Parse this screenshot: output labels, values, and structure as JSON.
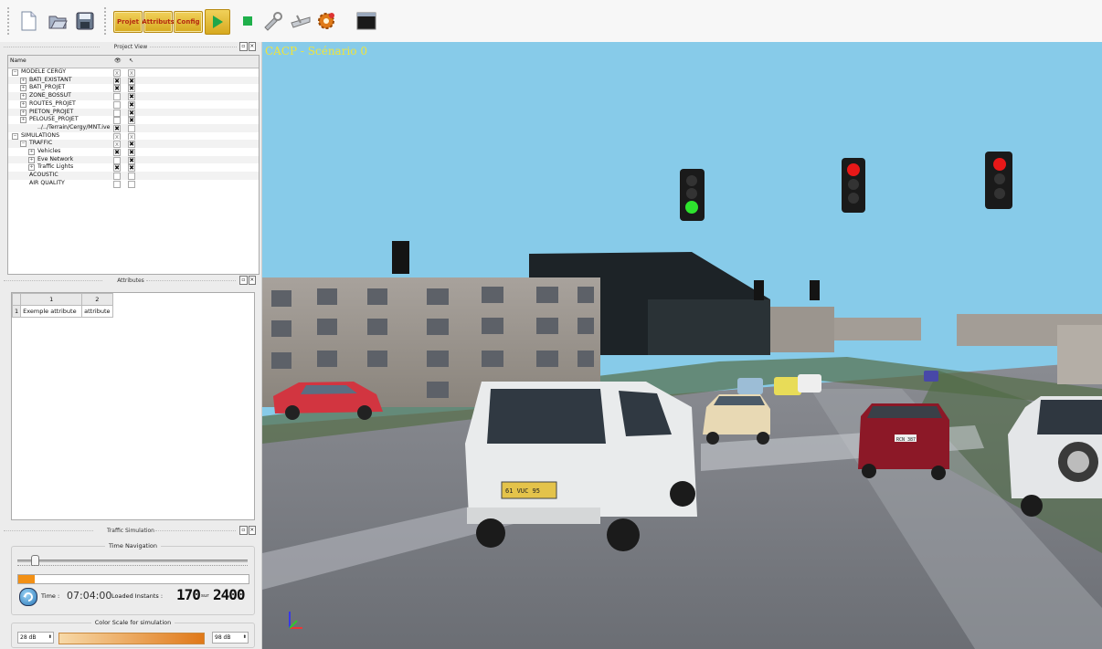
{
  "toolbar": {
    "buttons": [
      "new-file",
      "open-file",
      "save-file",
      "project",
      "attributes",
      "config",
      "play",
      "stop",
      "tools-a",
      "tools-b",
      "settings",
      "terminal"
    ],
    "mode_labels": {
      "project": "Projet",
      "attributes": "Attributs",
      "config": "Config"
    }
  },
  "project_view": {
    "title": "Project View",
    "columns": {
      "name": "Name"
    },
    "rows": [
      {
        "label": "MODELE CERGY",
        "indent": 0,
        "exp": "−",
        "vis": "x",
        "sel": "x",
        "visbold": false,
        "selbold": false
      },
      {
        "label": "BATI_EXISTANT",
        "indent": 1,
        "exp": "+",
        "vis": "✖",
        "sel": "✖",
        "visbold": true,
        "selbold": true
      },
      {
        "label": "BATI_PROJET",
        "indent": 1,
        "exp": "+",
        "vis": "✖",
        "sel": "✖",
        "visbold": true,
        "selbold": true
      },
      {
        "label": "ZONE_BOSSUT",
        "indent": 1,
        "exp": "+",
        "vis": "",
        "sel": "✖",
        "visbold": false,
        "selbold": true
      },
      {
        "label": "ROUTES_PROJET",
        "indent": 1,
        "exp": "+",
        "vis": "",
        "sel": "✖",
        "visbold": false,
        "selbold": true
      },
      {
        "label": "PIETON_PROJET",
        "indent": 1,
        "exp": "+",
        "vis": "",
        "sel": "✖",
        "visbold": false,
        "selbold": true
      },
      {
        "label": "PELOUSE_PROJET",
        "indent": 1,
        "exp": "+",
        "vis": "",
        "sel": "✖",
        "visbold": false,
        "selbold": true
      },
      {
        "label": "../../Terrain/Cergy/MNT.ive",
        "indent": 2,
        "exp": "",
        "vis": "✖",
        "sel": "",
        "visbold": true,
        "selbold": false
      },
      {
        "label": "SIMULATIONS",
        "indent": 0,
        "exp": "−",
        "vis": "x",
        "sel": "x",
        "visbold": false,
        "selbold": false
      },
      {
        "label": "TRAFFIC",
        "indent": 1,
        "exp": "−",
        "vis": "x",
        "sel": "✖",
        "visbold": false,
        "selbold": true
      },
      {
        "label": "Vehicles",
        "indent": 2,
        "exp": "+",
        "vis": "✖",
        "sel": "✖",
        "visbold": true,
        "selbold": true
      },
      {
        "label": "Eve Network",
        "indent": 2,
        "exp": "+",
        "vis": "",
        "sel": "✖",
        "visbold": false,
        "selbold": true
      },
      {
        "label": "Traffic Lights",
        "indent": 2,
        "exp": "+",
        "vis": "✖",
        "sel": "✖",
        "visbold": true,
        "selbold": true
      },
      {
        "label": "ACOUSTIC",
        "indent": 1,
        "exp": "",
        "vis": "",
        "sel": "",
        "visbold": false,
        "selbold": false
      },
      {
        "label": "AIR QUALITY",
        "indent": 1,
        "exp": "",
        "vis": "",
        "sel": "",
        "visbold": false,
        "selbold": false
      }
    ]
  },
  "attributes": {
    "title": "Attributes",
    "col1": "1",
    "col2": "2",
    "row_num": "1",
    "cell1": "Exemple attribute",
    "cell2": "attribute"
  },
  "traffic": {
    "title": "Traffic Simulation",
    "time_nav": "Time Navigation",
    "time_label": "Time :",
    "time_value": "07:04:00",
    "loaded_label": "Loaded Instants :",
    "loaded_value": "170",
    "sur": "sur",
    "total_value": "2400",
    "progress_fraction": 0.07,
    "color_scale": "Color Scale for simulation",
    "min_db": "28 dB",
    "max_db": "98 dB"
  },
  "viewport": {
    "scene_title": "CACP - Scénario 0",
    "plate_van": "61 VUC 95",
    "plate_car": "RCN 387"
  },
  "colors": {
    "sky": "#87cbe9",
    "scene_title": "#f0e43a",
    "gradient_start": "#f7d9a8",
    "gradient_end": "#e07818"
  }
}
